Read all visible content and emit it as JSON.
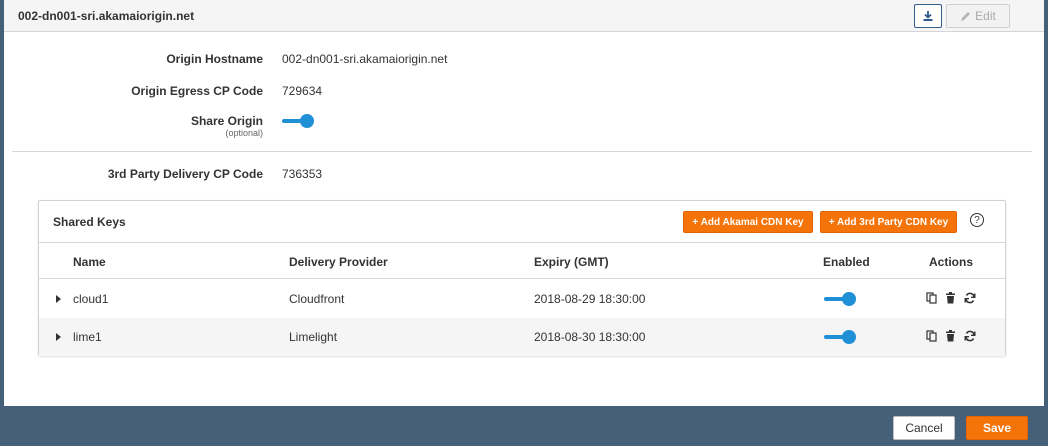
{
  "header": {
    "title": "002-dn001-sri.akamaiorigin.net",
    "edit_label": "Edit"
  },
  "fields": {
    "origin_hostname": {
      "label": "Origin Hostname",
      "value": "002-dn001-sri.akamaiorigin.net"
    },
    "origin_egress": {
      "label": "Origin Egress CP Code",
      "value": "729634"
    },
    "share_origin": {
      "label": "Share Origin",
      "sublabel": "(optional)",
      "enabled": true
    },
    "third_party": {
      "label": "3rd Party Delivery CP Code",
      "value": "736353"
    }
  },
  "shared_keys": {
    "title": "Shared Keys",
    "add_akamai_label": "+ Add Akamai CDN Key",
    "add_third_party_label": "+ Add 3rd Party CDN Key",
    "help_symbol": "?",
    "columns": {
      "name": "Name",
      "provider": "Delivery Provider",
      "expiry": "Expiry (GMT)",
      "enabled": "Enabled",
      "actions": "Actions"
    },
    "rows": [
      {
        "name": "cloud1",
        "provider": "Cloudfront",
        "expiry": "2018-08-29 18:30:00",
        "enabled": true
      },
      {
        "name": "lime1",
        "provider": "Limelight",
        "expiry": "2018-08-30 18:30:00",
        "enabled": true
      }
    ]
  },
  "footer": {
    "cancel_label": "Cancel",
    "save_label": "Save"
  },
  "colors": {
    "accent": "#1f8fd6",
    "primary_button": "#f5740a",
    "footer_bar": "#46607a"
  },
  "icons": [
    "download-icon",
    "pencil-icon",
    "help-icon",
    "caret-right-icon",
    "copy-icon",
    "trash-icon",
    "refresh-icon"
  ]
}
